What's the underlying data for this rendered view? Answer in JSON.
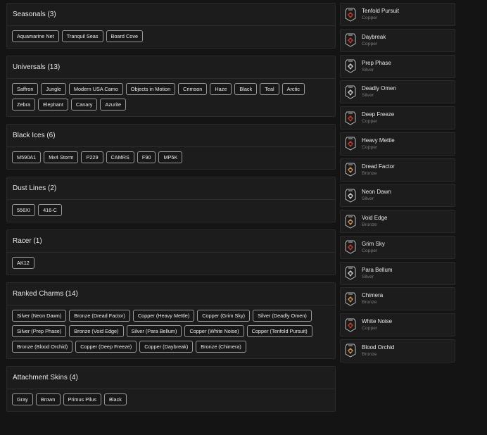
{
  "sections": [
    {
      "title": "Seasonals (3)",
      "items": [
        "Aquamarine Net",
        "Tranquil Seas",
        "Board Cove"
      ]
    },
    {
      "title": "Universals (13)",
      "items": [
        "Saffron",
        "Jungle",
        "Modern USA Camo",
        "Objects in Motion",
        "Crimson",
        "Haze",
        "Black",
        "Teal",
        "Arctic",
        "Zebra",
        "Elephant",
        "Canary",
        "Azurite"
      ]
    },
    {
      "title": "Black Ices (6)",
      "items": [
        "M590A1",
        "Mx4 Storm",
        "P229",
        "CAMRS",
        "F90",
        "MP5K"
      ]
    },
    {
      "title": "Dust Lines (2)",
      "items": [
        "556XI",
        "416-C"
      ]
    },
    {
      "title": "Racer (1)",
      "items": [
        "AK12"
      ]
    },
    {
      "title": "Ranked Charms (14)",
      "items": [
        "Silver (Neon Dawn)",
        "Bronze (Dread Factor)",
        "Copper (Heavy Mettle)",
        "Copper (Grim Sky)",
        "Silver (Deadly Omen)",
        "Silver (Prep Phase)",
        "Bronze (Void Edge)",
        "Silver (Para Bellum)",
        "Copper (White Noise)",
        "Copper (Tenfold Pursuit)",
        "Bronze (Blood Orchid)",
        "Copper (Deep Freeze)",
        "Copper (Daybreak)",
        "Bronze (Chimera)"
      ]
    },
    {
      "title": "Attachment Skins (4)",
      "items": [
        "Gray",
        "Brown",
        "Primus Pilus",
        "Black"
      ]
    }
  ],
  "ranks": [
    {
      "name": "Tenfold Pursuit",
      "tier": "Copper"
    },
    {
      "name": "Daybreak",
      "tier": "Copper"
    },
    {
      "name": "Prep Phase",
      "tier": "Silver"
    },
    {
      "name": "Deadly Omen",
      "tier": "Silver"
    },
    {
      "name": "Deep Freeze",
      "tier": "Copper"
    },
    {
      "name": "Heavy Mettle",
      "tier": "Copper"
    },
    {
      "name": "Dread Factor",
      "tier": "Bronze"
    },
    {
      "name": "Neon Dawn",
      "tier": "Silver"
    },
    {
      "name": "Void Edge",
      "tier": "Bronze"
    },
    {
      "name": "Grim Sky",
      "tier": "Copper"
    },
    {
      "name": "Para Bellum",
      "tier": "Silver"
    },
    {
      "name": "Chimera",
      "tier": "Bronze"
    },
    {
      "name": "White Noise",
      "tier": "Copper"
    },
    {
      "name": "Blood Orchid",
      "tier": "Bronze"
    }
  ],
  "tier_colors": {
    "Copper": "#c0392b",
    "Silver": "#c8c8c8",
    "Bronze": "#c98a4a"
  },
  "icons": {
    "rank": "rank-badge-icon"
  }
}
